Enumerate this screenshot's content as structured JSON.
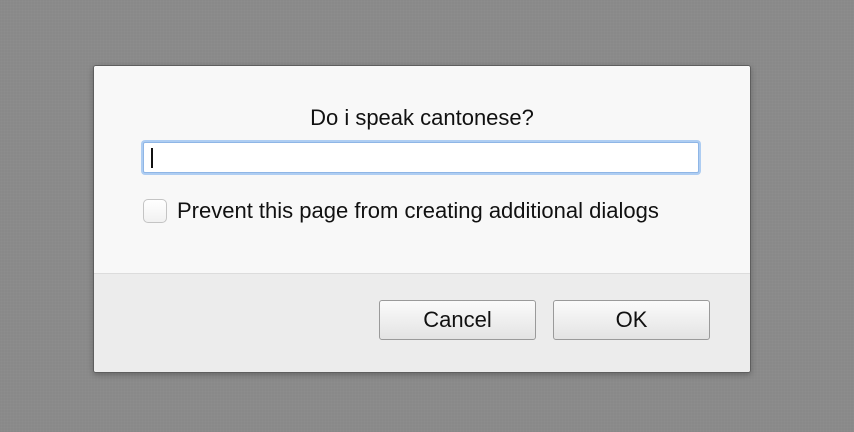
{
  "dialog": {
    "message": "Do i speak cantonese?",
    "input": {
      "value": "",
      "placeholder": ""
    },
    "prevent_dialogs_label": "Prevent this page from creating additional dialogs",
    "prevent_dialogs_checked": false,
    "buttons": {
      "cancel_label": "Cancel",
      "ok_label": "OK"
    }
  }
}
